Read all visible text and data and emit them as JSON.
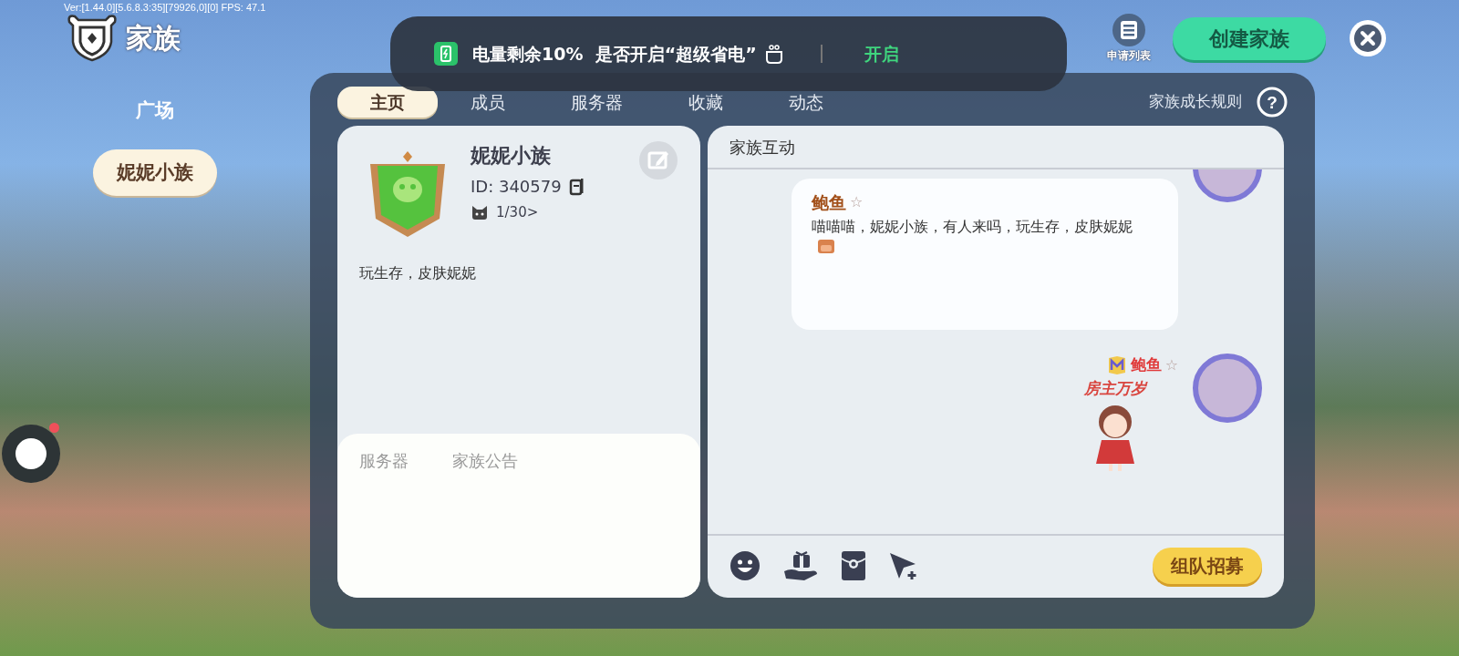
{
  "version": "Ver:[1.44.0][5.6.8.3:35][79926,0][0] FPS: 47.1",
  "title": "家族",
  "sidebar": {
    "items": [
      {
        "label": "广场",
        "selected": false
      },
      {
        "label": "妮妮小族",
        "selected": true
      }
    ]
  },
  "toolbar": {
    "apply_list": "申请列表",
    "create_button": "创建家族"
  },
  "notification": {
    "message": "电量剩余10%  是否开启“超级省电”",
    "action": "开启"
  },
  "tabs": [
    {
      "label": "主页",
      "selected": true
    },
    {
      "label": "成员",
      "selected": false
    },
    {
      "label": "服务器",
      "selected": false
    },
    {
      "label": "收藏",
      "selected": false
    },
    {
      "label": "动态",
      "selected": false
    }
  ],
  "growth_rules": "家族成长规则",
  "help_icon": "?",
  "family": {
    "name": "妮妮小族",
    "id": "ID: 340579",
    "members": "1/30>",
    "description": "玩生存，皮肤妮妮"
  },
  "info_tabs": [
    {
      "label": "服务器"
    },
    {
      "label": "家族公告"
    }
  ],
  "chat": {
    "title": "家族互动",
    "messages": [
      {
        "kind": "post",
        "sender": "鲍鱼",
        "mark": "☆",
        "text": "喵喵喵，妮妮小族，有人来吗，玩生存，皮肤妮妮"
      },
      {
        "kind": "sticker",
        "sender": "鲍鱼",
        "mark": "☆",
        "sticker_text": "房主万岁"
      }
    ],
    "recruit_button": "组队招募"
  }
}
